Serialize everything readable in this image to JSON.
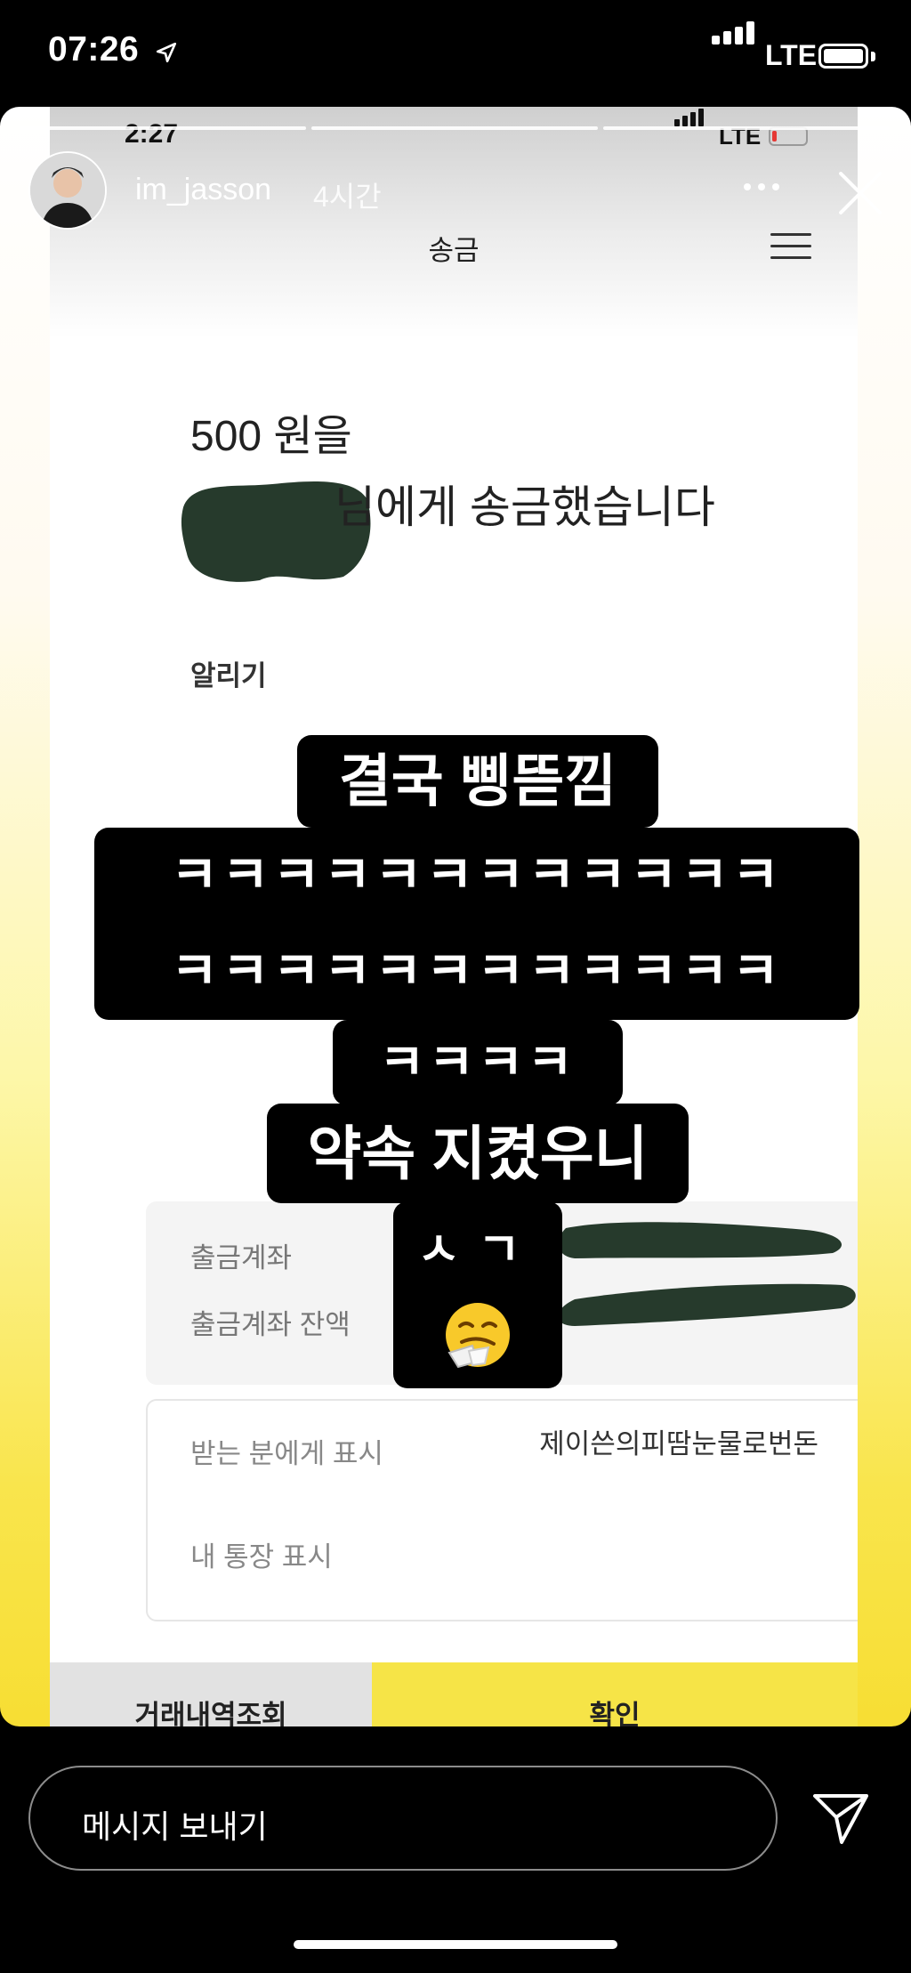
{
  "status_bar": {
    "time": "07:26",
    "network": "LTE"
  },
  "story": {
    "username": "im_jasson",
    "time_ago": "4시간"
  },
  "screenshot": {
    "status_time": "2:27",
    "network": "LTE",
    "title": "송금",
    "amount_line": "500 원을",
    "recipient_suffix": "님에게 송금했습니다",
    "notify_label": "알리기",
    "withdraw_account_label": "출금계좌",
    "withdraw_balance_label": "출금계좌 잔액",
    "recipient_display_label": "받는 분에게 표시",
    "recipient_display_value": "제이쓴의피땀눈물로번돈",
    "my_account_display_label": "내 통장 표시",
    "history_button": "거래내역조회",
    "confirm_button": "확인"
  },
  "overlay": {
    "line1": "결국 삥뜯낌",
    "line2": "ㅋㅋㅋㅋㅋㅋㅋㅋㅋㅋㅋㅋ",
    "line3": "ㅋㅋㅋㅋㅋㅋㅋㅋㅋㅋㅋㅋ",
    "line4": "ㅋㅋㅋㅋ",
    "line5": "약속 지켰우니",
    "line6": "ㅅㄱ",
    "emoji": "sneezing-face"
  },
  "message_bar": {
    "placeholder": "메시지 보내기"
  },
  "icons": {
    "location": "location-arrow-icon",
    "send": "paper-plane-icon",
    "close": "close-icon",
    "more": "more-dots-icon",
    "menu": "hamburger-menu-icon"
  },
  "colors": {
    "story_bg": "#f7de33",
    "confirm_button": "#f6e447",
    "redaction": "#263a2c"
  }
}
